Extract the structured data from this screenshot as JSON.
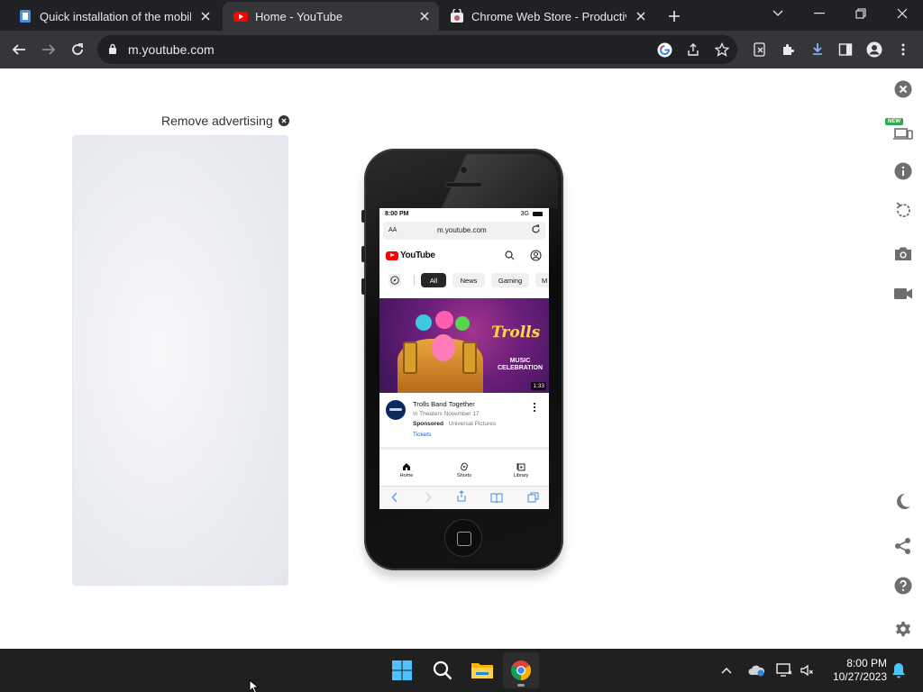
{
  "browser": {
    "tabs": [
      {
        "title": "Quick installation of the mobile em",
        "favicon": "doc-icon"
      },
      {
        "title": "Home - YouTube",
        "favicon": "youtube-icon",
        "active": true
      },
      {
        "title": "Chrome Web Store - Productivity",
        "favicon": "webstore-icon"
      }
    ],
    "url": "m.youtube.com"
  },
  "page": {
    "remove_ad_label": "Remove advertising",
    "new_badge": "NEW"
  },
  "phone": {
    "status_time": "8:00 PM",
    "status_network": "3G",
    "address_aa": "AA",
    "address_url": "m.youtube.com",
    "yt_logo_text": "YouTube",
    "chips": [
      "All",
      "News",
      "Gaming",
      "M"
    ],
    "video": {
      "brand": "Trolls",
      "subtitle": "MUSIC CELEBRATION",
      "duration": "1:33",
      "title": "Trolls Band Together",
      "line1": "In Theaters November 17",
      "sponsored": "Sponsored",
      "advertiser": " · Universal Pictures",
      "cta": "Tickets"
    },
    "bottom_nav": [
      "Home",
      "Shorts",
      "Library"
    ]
  },
  "taskbar": {
    "time": "8:00 PM",
    "date": "10/27/2023"
  },
  "colors": {
    "chrome_dark": "#202124",
    "chrome_toolbar": "#35363a",
    "youtube_red": "#ff0000",
    "taskbar": "#202020"
  }
}
